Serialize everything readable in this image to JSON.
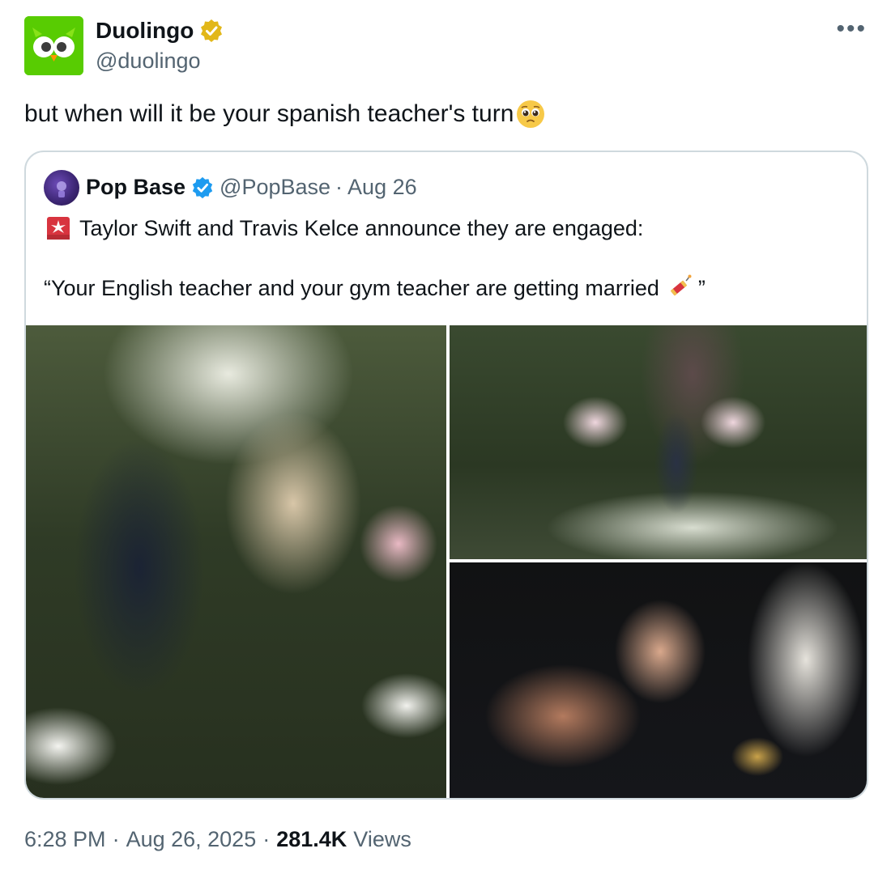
{
  "author": {
    "display_name": "Duolingo",
    "handle": "@duolingo",
    "brand_color": "#58cc02",
    "avatar_icon": "duolingo-owl-icon",
    "badge_icon": "gold-verified-badge-icon",
    "more_label": "•••"
  },
  "tweet": {
    "text": "but when will it be your spanish teacher's turn",
    "emoji": "pleading-face-emoji"
  },
  "quote": {
    "display_name": "Pop Base",
    "handle": "@PopBase",
    "separator": "·",
    "date": "Aug 26",
    "badge_icon": "blue-verified-badge-icon",
    "line1": "Taylor Swift and Travis Kelce announce they are engaged:",
    "line1_emoji": "siren-emoji",
    "line2_open": "“Your English teacher and your gym teacher are getting married",
    "line2_emoji": "firecracker-emoji",
    "line2_close": "”",
    "images": [
      {
        "name": "couple-embrace-photo"
      },
      {
        "name": "garden-proposal-photo"
      },
      {
        "name": "engagement-ring-hands-photo"
      }
    ]
  },
  "footer": {
    "time": "6:28 PM",
    "sep1": "·",
    "date": "Aug 26, 2025",
    "sep2": "·",
    "views_count": "281.4K",
    "views_label": "Views"
  }
}
